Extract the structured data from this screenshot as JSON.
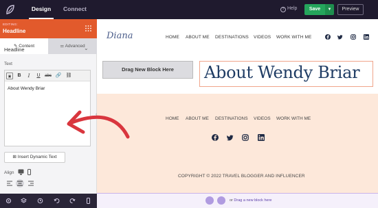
{
  "topbar": {
    "tabs": [
      "Design",
      "Connect"
    ],
    "help_label": "Help",
    "save_label": "Save",
    "preview_label": "Preview"
  },
  "sidebar": {
    "editing_label": "EDITING:",
    "block_title": "Headline",
    "tabs": [
      "Content",
      "Advanced"
    ],
    "section_title": "Headline",
    "text_label": "Text",
    "toolbar_buttons": [
      "source",
      "B",
      "I",
      "U",
      "strikethrough",
      "link",
      "unlink"
    ],
    "editor_value": "About Wendy Briar",
    "insert_button": "Insert Dynamic Text",
    "align_label": "Align",
    "align_selected": "center"
  },
  "site": {
    "brand": "Diana",
    "nav": [
      "HOME",
      "ABOUT ME",
      "DESTINATIONS",
      "VIDEOS",
      "WORK WITH ME"
    ],
    "social": [
      "facebook-icon",
      "twitter-icon",
      "instagram-icon",
      "linkedin-icon"
    ],
    "drag_block_label": "Drag New Block Here",
    "headline": "About Wendy Briar",
    "footer_nav": [
      "HOME",
      "ABOUT ME",
      "DESTINATIONS",
      "VIDEOS",
      "WORK WITH ME"
    ],
    "copyright": "COPYRIGHT © 2022 TRAVEL BLOGGER AND INFLUENCER",
    "dropzone_or": "or",
    "dropzone_label": "Drag a new block here"
  },
  "colors": {
    "topbar": "#1f1a2e",
    "editing_header": "#e25a2c",
    "save": "#25a55c",
    "headline": "#1f3c64",
    "footer_bg": "#fde8da",
    "arrow": "#d9363e"
  }
}
